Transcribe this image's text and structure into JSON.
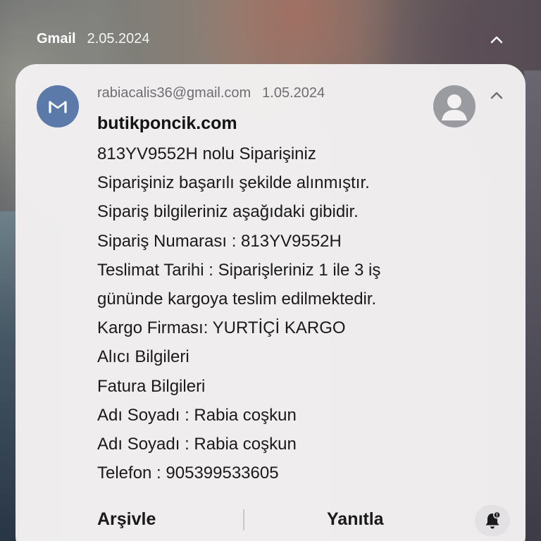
{
  "notification_header": {
    "app_name": "Gmail",
    "date": "2.05.2024",
    "collapse_icon": "chevron-up-icon"
  },
  "email": {
    "sender": "rabiacalis36@gmail.com",
    "date": "1.05.2024",
    "app_icon": "gmail-m-icon",
    "profile_icon": "person-icon",
    "subject": "butikponcik.com",
    "body_lines": [
      "813YV9552H nolu Siparişiniz",
      "Siparişiniz başarılı şekilde alınmıştır.",
      "Sipariş bilgileriniz aşağıdaki gibidir.",
      "Sipariş Numarası : 813YV9552H",
      "Teslimat Tarihi : Siparişleriniz 1 ile 3 iş",
      "gününde kargoya teslim edilmektedir.",
      "Kargo Firması: YURTİÇİ KARGO",
      "Alıcı Bilgileri",
      "Fatura Bilgileri",
      "Adı Soyadı : Rabia coşkun",
      "Adı Soyadı : Rabia coşkun",
      "Telefon : 905399533605"
    ]
  },
  "actions": {
    "archive_label": "Arşivle",
    "reply_label": "Yanıtla",
    "bell_icon": "notification-settings-bell-icon"
  },
  "colors": {
    "avatar_background": "#5b7aaa",
    "card_background": "#f3f1f2",
    "meta_text": "#6e6e72",
    "primary_text": "#1a1a1a"
  }
}
